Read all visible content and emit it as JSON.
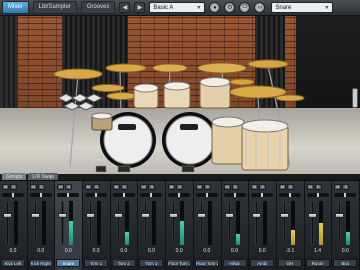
{
  "toolbar": {
    "mixer_tab": "Mixer",
    "lib_tab": "Lib/Sampler",
    "grooves_tab": "Grooves",
    "prev_icon": "chevron-left-icon",
    "next_icon": "chevron-right-icon",
    "preset_value": "Basic A",
    "instrument_value": "Snare"
  },
  "stage": {
    "tabs": [
      "Groups",
      "L/R Swap"
    ]
  },
  "mixer": {
    "channels": [
      {
        "name": "Kick Left",
        "value": "0.0",
        "meter": 0.0
      },
      {
        "name": "Kick Right",
        "value": "0.0",
        "meter": 0.0
      },
      {
        "name": "Snare",
        "value": "0.0",
        "meter": 0.55
      },
      {
        "name": "Tom 1",
        "value": "0.0",
        "meter": 0.0
      },
      {
        "name": "Tom 2",
        "value": "0.0",
        "meter": 0.3
      },
      {
        "name": "Tom 3",
        "value": "0.0",
        "meter": 0.0
      },
      {
        "name": "Floor Tom 1",
        "value": "0.0",
        "meter": 0.55
      },
      {
        "name": "Floor Tom 2",
        "value": "0.0",
        "meter": 0.0
      },
      {
        "name": "Hihat",
        "value": "0.0",
        "meter": 0.25
      },
      {
        "name": "Ambi",
        "value": "0.0",
        "meter": 0.0
      },
      {
        "name": "OH",
        "value": "-3.1",
        "meter": 0.35
      },
      {
        "name": "Room",
        "value": "1.4",
        "meter": 0.5
      },
      {
        "name": "Bus",
        "value": "0.0",
        "meter": 0.3
      }
    ]
  },
  "colors": {
    "accent": "#2e7ab8",
    "meter_green": "#3fd5b0",
    "meter_yellow": "#e2d04a"
  }
}
